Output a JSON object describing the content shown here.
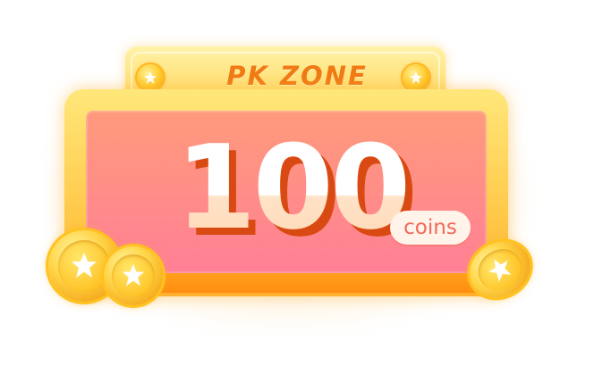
{
  "badge": {
    "title": "PK ZONE",
    "amount": "100",
    "unit": "coins"
  },
  "icons": {
    "rivet": "star-rivet-icon",
    "coin": "gold-star-coin-icon"
  },
  "colors": {
    "title": "#f07a13",
    "frame_gold": "#ffc94a",
    "panel_top": "#ff9a7c",
    "panel_bottom": "#ff7f96",
    "amount_shadow": "#d94a12",
    "unit_text": "#f1695a"
  }
}
